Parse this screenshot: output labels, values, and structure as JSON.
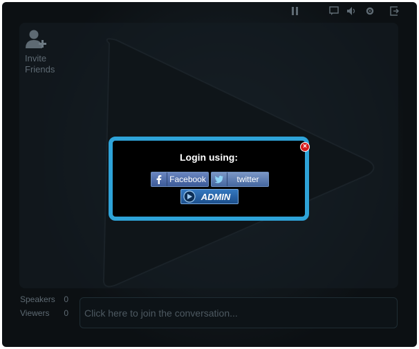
{
  "sidebar": {
    "invite_line1": "Invite",
    "invite_line2": "Friends"
  },
  "stats": {
    "speakers_label": "Speakers",
    "speakers_count": "0",
    "viewers_label": "Viewers",
    "viewers_count": "0"
  },
  "chat": {
    "placeholder": "Click here to join the conversation..."
  },
  "login_modal": {
    "title": "Login using:",
    "facebook_label": "Facebook",
    "twitter_label": "twitter",
    "admin_label": "ADMIN"
  },
  "colors": {
    "modal_border": "#2ea3d8",
    "facebook_blue": "#3c5a98",
    "close_red": "#d61d1d"
  },
  "icons": [
    "pause-icon",
    "speech-icon",
    "volume-icon",
    "settings-icon",
    "exit-icon",
    "add-user-icon",
    "close-icon",
    "facebook-icon",
    "twitter-icon",
    "admin-logo-icon"
  ]
}
